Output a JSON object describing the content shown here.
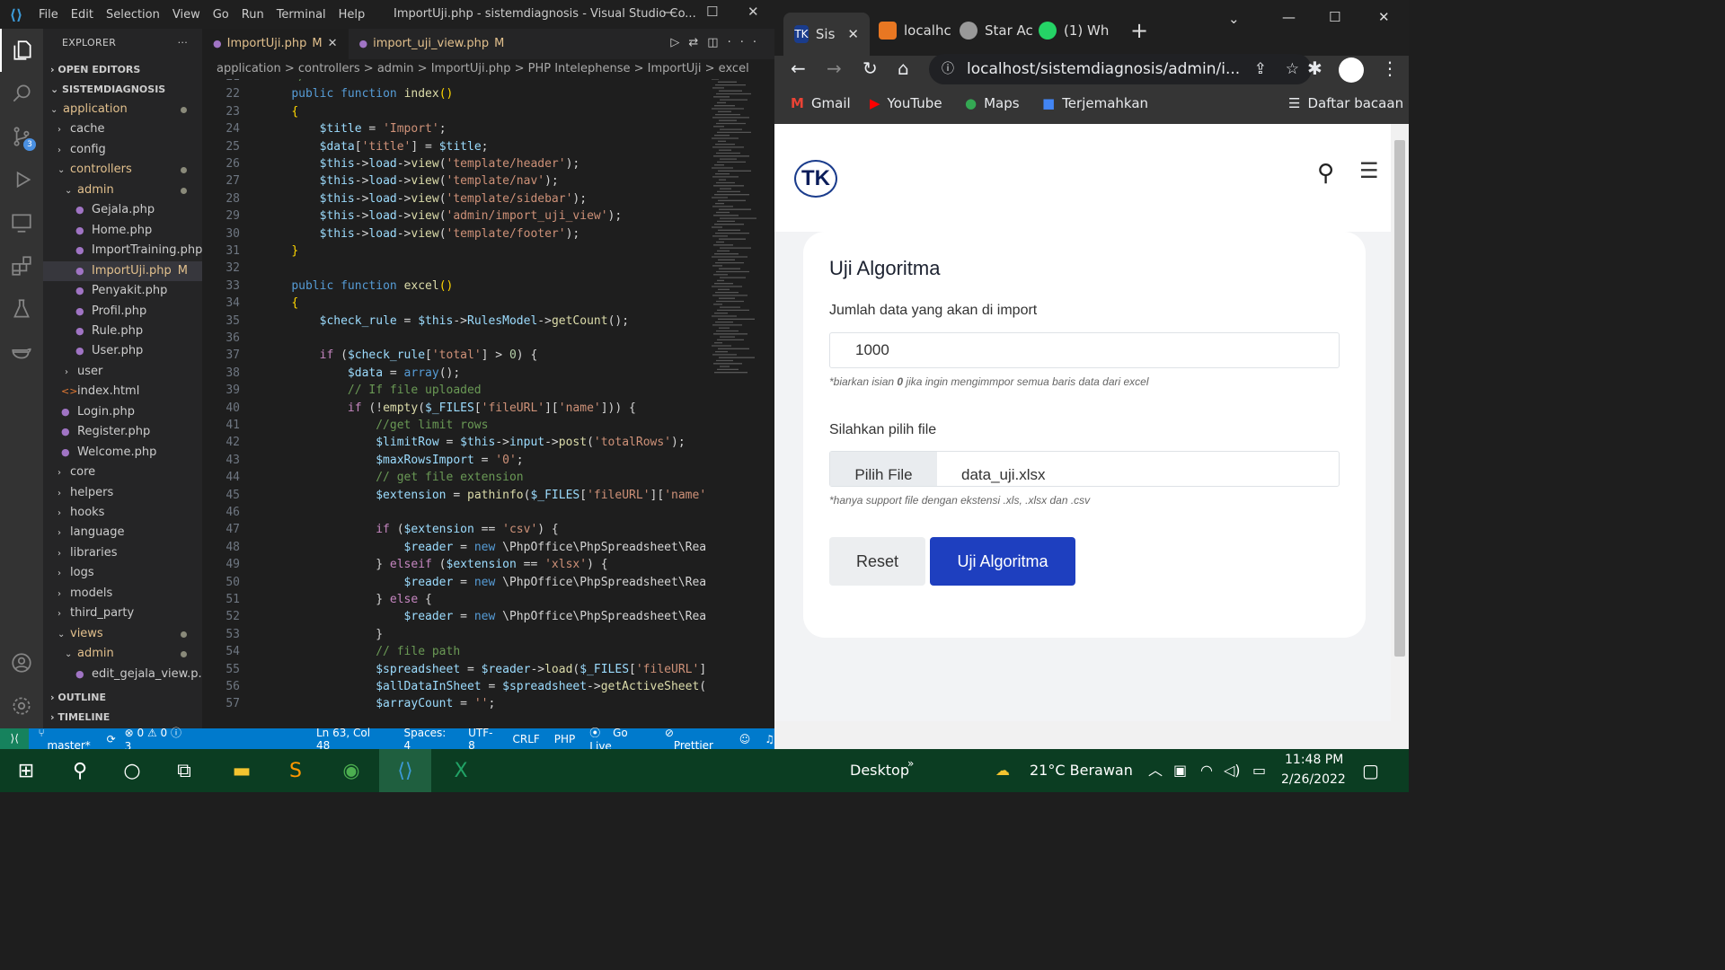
{
  "vscode": {
    "menu": [
      "File",
      "Edit",
      "Selection",
      "View",
      "Go",
      "Run",
      "Terminal",
      "Help"
    ],
    "window_title": "ImportUji.php - sistemdiagnosis - Visual Studio Co...",
    "explorer_title": "EXPLORER",
    "sections": {
      "open_editors": "OPEN EDITORS",
      "project": "SISTEMDIAGNOSIS",
      "outline": "OUTLINE",
      "timeline": "TIMELINE"
    },
    "scm_badge": "3",
    "tree": [
      {
        "label": "application",
        "indent": 1,
        "type": "folder-open",
        "color": "#e2c08d",
        "dot": true
      },
      {
        "label": "cache",
        "indent": 2,
        "type": "folder",
        "color": "#ccc"
      },
      {
        "label": "config",
        "indent": 2,
        "type": "folder",
        "color": "#ccc"
      },
      {
        "label": "controllers",
        "indent": 2,
        "type": "folder-open",
        "color": "#e2c08d",
        "dot": true
      },
      {
        "label": "admin",
        "indent": 3,
        "type": "folder-open",
        "color": "#e2c08d",
        "dot": true
      },
      {
        "label": "Gejala.php",
        "indent": 4,
        "type": "php",
        "color": "#ccc"
      },
      {
        "label": "Home.php",
        "indent": 4,
        "type": "php",
        "color": "#ccc"
      },
      {
        "label": "ImportTraining.php",
        "indent": 4,
        "type": "php",
        "color": "#ccc"
      },
      {
        "label": "ImportUji.php",
        "indent": 4,
        "type": "php",
        "color": "#e2c08d",
        "mod": "M",
        "selected": true
      },
      {
        "label": "Penyakit.php",
        "indent": 4,
        "type": "php",
        "color": "#ccc"
      },
      {
        "label": "Profil.php",
        "indent": 4,
        "type": "php",
        "color": "#ccc"
      },
      {
        "label": "Rule.php",
        "indent": 4,
        "type": "php",
        "color": "#ccc"
      },
      {
        "label": "User.php",
        "indent": 4,
        "type": "php",
        "color": "#ccc"
      },
      {
        "label": "user",
        "indent": 3,
        "type": "folder",
        "color": "#ccc"
      },
      {
        "label": "index.html",
        "indent": 2,
        "type": "html",
        "color": "#ccc"
      },
      {
        "label": "Login.php",
        "indent": 2,
        "type": "php",
        "color": "#ccc"
      },
      {
        "label": "Register.php",
        "indent": 2,
        "type": "php",
        "color": "#ccc"
      },
      {
        "label": "Welcome.php",
        "indent": 2,
        "type": "php",
        "color": "#ccc"
      },
      {
        "label": "core",
        "indent": 2,
        "type": "folder",
        "color": "#ccc"
      },
      {
        "label": "helpers",
        "indent": 2,
        "type": "folder",
        "color": "#ccc"
      },
      {
        "label": "hooks",
        "indent": 2,
        "type": "folder",
        "color": "#ccc"
      },
      {
        "label": "language",
        "indent": 2,
        "type": "folder",
        "color": "#ccc"
      },
      {
        "label": "libraries",
        "indent": 2,
        "type": "folder",
        "color": "#ccc"
      },
      {
        "label": "logs",
        "indent": 2,
        "type": "folder",
        "color": "#ccc"
      },
      {
        "label": "models",
        "indent": 2,
        "type": "folder",
        "color": "#ccc"
      },
      {
        "label": "third_party",
        "indent": 2,
        "type": "folder",
        "color": "#ccc"
      },
      {
        "label": "views",
        "indent": 2,
        "type": "folder-open",
        "color": "#e2c08d",
        "dot": true
      },
      {
        "label": "admin",
        "indent": 3,
        "type": "folder-open",
        "color": "#e2c08d",
        "dot": true
      },
      {
        "label": "edit_gejala_view.p...",
        "indent": 4,
        "type": "php",
        "color": "#ccc"
      }
    ],
    "tabs": [
      {
        "label": "ImportUji.php",
        "mod": "M",
        "active": true
      },
      {
        "label": "import_uji_view.php",
        "mod": "M",
        "active": false
      }
    ],
    "breadcrumb": "application > controllers > admin > ImportUji.php > PHP Intelephense > ImportUji > excel",
    "status": {
      "branch": "master*",
      "problems": "⊗ 0 ⚠ 0 ⓘ 3",
      "position": "Ln 63, Col 48",
      "spaces": "Spaces: 4",
      "encoding": "UTF-8",
      "eol": "CRLF",
      "lang": "PHP",
      "golive": "Go Live",
      "prettier": "Prettier"
    },
    "code_first_line": 21,
    "code": [
      "<span class='c'>    */</span>",
      "    <span class='kw'>public</span> <span class='kw'>function</span> <span class='f'>index</span><span class='b'>()</span>",
      "    <span class='b'>{</span>",
      "        <span class='v'>$title</span> = <span class='s'>'Import'</span>;",
      "        <span class='v'>$data</span>[<span class='s'>'title'</span>] = <span class='v'>$title</span>;",
      "        <span class='v'>$this</span>-><span class='v'>load</span>-><span class='f'>view</span>(<span class='s'>'template/header'</span>);",
      "        <span class='v'>$this</span>-><span class='v'>load</span>-><span class='f'>view</span>(<span class='s'>'template/nav'</span>);",
      "        <span class='v'>$this</span>-><span class='v'>load</span>-><span class='f'>view</span>(<span class='s'>'template/sidebar'</span>);",
      "        <span class='v'>$this</span>-><span class='v'>load</span>-><span class='f'>view</span>(<span class='s'>'admin/import_uji_view'</span>);",
      "        <span class='v'>$this</span>-><span class='v'>load</span>-><span class='f'>view</span>(<span class='s'>'template/footer'</span>);",
      "    <span class='b'>}</span>",
      "",
      "    <span class='kw'>public</span> <span class='kw'>function</span> <span class='f'>excel</span><span class='b'>()</span>",
      "    <span class='b'>{</span>",
      "        <span class='v'>$check_rule</span> = <span class='v'>$this</span>-><span class='v'>RulesModel</span>-><span class='f'>getCount</span>();",
      "",
      "        <span class='k'>if</span> (<span class='v'>$check_rule</span>[<span class='s'>'total'</span>] > <span class='n'>0</span>) {",
      "            <span class='v'>$data</span> = <span class='kw'>array</span>();",
      "            <span class='c'>// If file uploaded</span>",
      "            <span class='k'>if</span> (!<span class='f'>empty</span>(<span class='v'>$_FILES</span>[<span class='s'>'fileURL'</span>][<span class='s'>'name'</span>])) {",
      "                <span class='c'>//get limit rows</span>",
      "                <span class='v'>$limitRow</span> = <span class='v'>$this</span>-><span class='v'>input</span>-><span class='f'>post</span>(<span class='s'>'totalRows'</span>);",
      "                <span class='v'>$maxRowsImport</span> = <span class='s'>'0'</span>;",
      "                <span class='c'>// get file extension</span>",
      "                <span class='v'>$extension</span> = <span class='f'>pathinfo</span>(<span class='v'>$_FILES</span>[<span class='s'>'fileURL'</span>][<span class='s'>'name'</span>",
      "",
      "                <span class='k'>if</span> (<span class='v'>$extension</span> == <span class='s'>'csv'</span>) {",
      "                    <span class='v'>$reader</span> = <span class='kw'>new</span> \\PhpOffice\\PhpSpreadsheet\\Rea",
      "                } <span class='k'>elseif</span> (<span class='v'>$extension</span> == <span class='s'>'xlsx'</span>) {",
      "                    <span class='v'>$reader</span> = <span class='kw'>new</span> \\PhpOffice\\PhpSpreadsheet\\Rea",
      "                } <span class='k'>else</span> {",
      "                    <span class='v'>$reader</span> = <span class='kw'>new</span> \\PhpOffice\\PhpSpreadsheet\\Rea",
      "                }",
      "                <span class='c'>// file path</span>",
      "                <span class='v'>$spreadsheet</span> = <span class='v'>$reader</span>-><span class='f'>load</span>(<span class='v'>$_FILES</span>[<span class='s'>'fileURL'</span>]",
      "                <span class='v'>$allDataInSheet</span> = <span class='v'>$spreadsheet</span>-><span class='f'>getActiveSheet</span>(",
      "                <span class='v'>$arrayCount</span> = <span class='s'>''</span>;"
    ]
  },
  "chrome": {
    "tabs": [
      "Sis",
      "localhc",
      "Star Ac",
      "(1) Wh"
    ],
    "url": "localhost/sistemdiagnosis/admin/i...",
    "bookmarks": [
      "Gmail",
      "YouTube",
      "Maps",
      "Terjemahkan"
    ],
    "reading_list": "Daftar bacaan"
  },
  "page": {
    "logo": "TK",
    "card_title": "Uji Algoritma",
    "rows_label": "Jumlah data yang akan di import",
    "rows_value": "1000",
    "rows_hint_pre": "*biarkan isian ",
    "rows_hint_bold": "0",
    "rows_hint_post": " jika ingin mengimmpor semua baris data dari excel",
    "file_label": "Silahkan pilih file",
    "file_button": "Pilih File",
    "file_name": "data_uji.xlsx",
    "file_hint": "*hanya support file dengan ekstensi .xls, .xlsx dan .csv",
    "reset_label": "Reset",
    "submit_label": "Uji Algoritma",
    "submit_color": "#1e3fbf"
  },
  "taskbar": {
    "desktop": "Desktop",
    "weather": "21°C  Berawan",
    "time": "11:48 PM",
    "date": "2/26/2022"
  }
}
